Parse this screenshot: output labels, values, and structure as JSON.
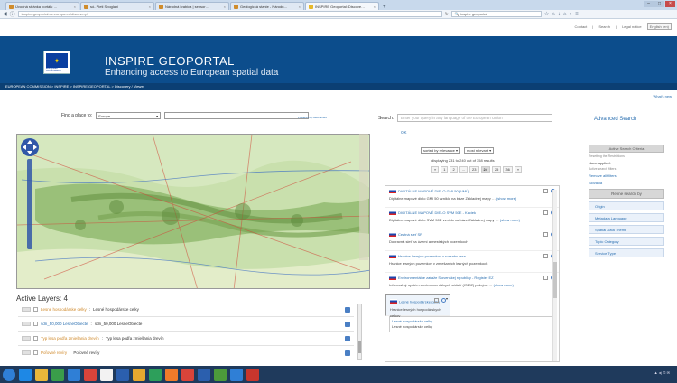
{
  "browser": {
    "tabs": [
      {
        "label": "Úvodná stránka portálu …"
      },
      {
        "label": "só- Pleti Sboglani"
      },
      {
        "label": "Národná krabica | sensor…"
      },
      {
        "label": "Geologická stanie - Národn…"
      },
      {
        "label": "INSPIRE Geoportal: Discove…"
      }
    ],
    "url": "inspire-geoportal.ec.europa.eu/discovery/",
    "search_value": "inspire geoportal"
  },
  "toplinks": {
    "contact": "Contact",
    "search": "Search",
    "legal": "Legal notice",
    "lang": "English (en)"
  },
  "header": {
    "logo_text": "European Commission",
    "title": "INSPIRE GEOPORTAL",
    "subtitle": "Enhancing access to European spatial data"
  },
  "breadcrumb": "EUROPEAN COMMISSION > INSPIRE > INSPIRE GEOPORTAL > Discovery / Viewer",
  "whats_new": "What's new",
  "map_panel": {
    "find_label": "Find a place to:",
    "find_value": "Europe",
    "powered": "Powered by GeoNames",
    "active_layers_label": "Active Layers: 4",
    "layers": [
      {
        "title": "Lesné hospodárske celky",
        "desc": "Lesné hospodárske celky"
      },
      {
        "title": "sdn_50,000 LesneObiecte",
        "desc": "sdn_50,000 LesneObiecte"
      },
      {
        "title": "Typ lesa podľa zmiešania drevín",
        "desc": "Typ lesa podľa zmiešania drevín"
      },
      {
        "title": "Poľovné revíry",
        "desc": "Poľovné revíry"
      }
    ]
  },
  "search_panel": {
    "label": "Search:",
    "placeholder": "Enter your query in any language of the European Union",
    "ok": "OK",
    "advanced": "Advanced Search",
    "sort_by": "sorted by relevance",
    "sort_order": "most relevant",
    "displaying": "displaying 231 to 240 out of 358 results",
    "pages": [
      "«",
      "1",
      "2",
      "...",
      "23",
      "24",
      "25",
      "36",
      "»"
    ],
    "current_page": "24",
    "results": [
      {
        "title": "DIGITÁLNE MAPOVÉ DIELO GMI 50 (VMÚ)",
        "desc": "Digitálne mapové dielo GMI 50 vzniklo na báze Základnej mapy …",
        "more": "(show more)"
      },
      {
        "title": "DIGITÁLNE MAPOVÉ DIELO SVM 50E - Kaciek",
        "desc": "Digitálne mapové dielo SVM 50E vzniklo na báze Základnej mapy …",
        "more": "(show more)"
      },
      {
        "title": "Cestná sieť SR",
        "desc": "Dopravná sieť na území a mestských pozemkoch",
        "more": ""
      },
      {
        "title": "Hranice lesných pozemkov v rozsahu lesa",
        "desc": "Hranice lesných pozemkov v zmiešaných lesných pozemkoch",
        "more": ""
      },
      {
        "title": "Environmentálne zaťaže Slovenskej republiky - Register EZ",
        "desc": "Informačný systém environmentálnych záťaží (IS EZ) pokrýva …",
        "more": "(show more)"
      },
      {
        "title": "Lesné hospodárske celky",
        "desc": "Hranice lesných hospodárskych celkov",
        "more": ""
      }
    ],
    "child": {
      "title": "Lesné hospodárske celky",
      "desc": "Lesné hospodárske celky"
    }
  },
  "sidebar": {
    "active_criteria": "Active Search Criteria",
    "hint": "Resetting the Restrictions",
    "none": "None applied.",
    "filters_hint": "Active search filters",
    "remove_all": "Remove all filters",
    "slovakia": "Slovakia",
    "refine": "Refine search by",
    "facets": [
      "Origin",
      "Metadata Language",
      "Spatial Data Theme",
      "Topic Category",
      "Service Type"
    ]
  }
}
